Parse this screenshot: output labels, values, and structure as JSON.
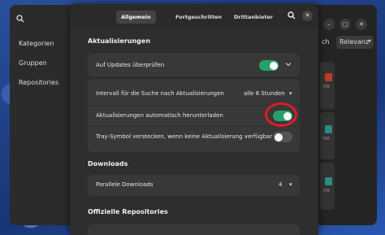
{
  "background_window": {
    "sidebar": [
      "Kategorien",
      "Gruppen",
      "Repositories"
    ],
    "sort_prefix": "ch",
    "sort_label": "Relevanz",
    "size_label": "MB",
    "minimize_glyph": "–",
    "restore_glyph": "▢",
    "close_glyph": "✕"
  },
  "dialog": {
    "tabs": [
      "Allgemein",
      "Fortgeschritten",
      "Drittanbieter"
    ],
    "active_tab": "Allgemein",
    "close_glyph": "✕",
    "sections": {
      "updates": {
        "title": "Aktualisierungen",
        "check_updates": {
          "label": "Auf Updates überprüfen",
          "enabled": true
        },
        "interval": {
          "label": "Intervall für die Suche nach Aktualisierungen",
          "value": "alle 6 Stunden"
        },
        "auto_download": {
          "label": "Aktualisierungen automatisch herunterladen",
          "enabled": true
        },
        "tray": {
          "label": "Tray-Symbol verstecken, wenn keine Aktualisierung verfügbar",
          "enabled": false
        }
      },
      "downloads": {
        "title": "Downloads",
        "parallel": {
          "label": "Parallele Downloads",
          "value": "4"
        }
      },
      "repos": {
        "title": "Offizielle Repositories"
      }
    }
  },
  "colors": {
    "accent_green": "#26a269",
    "highlight_red": "#e01b24",
    "tag_red": "#c0392b",
    "tag_teal": "#2a8c82"
  }
}
